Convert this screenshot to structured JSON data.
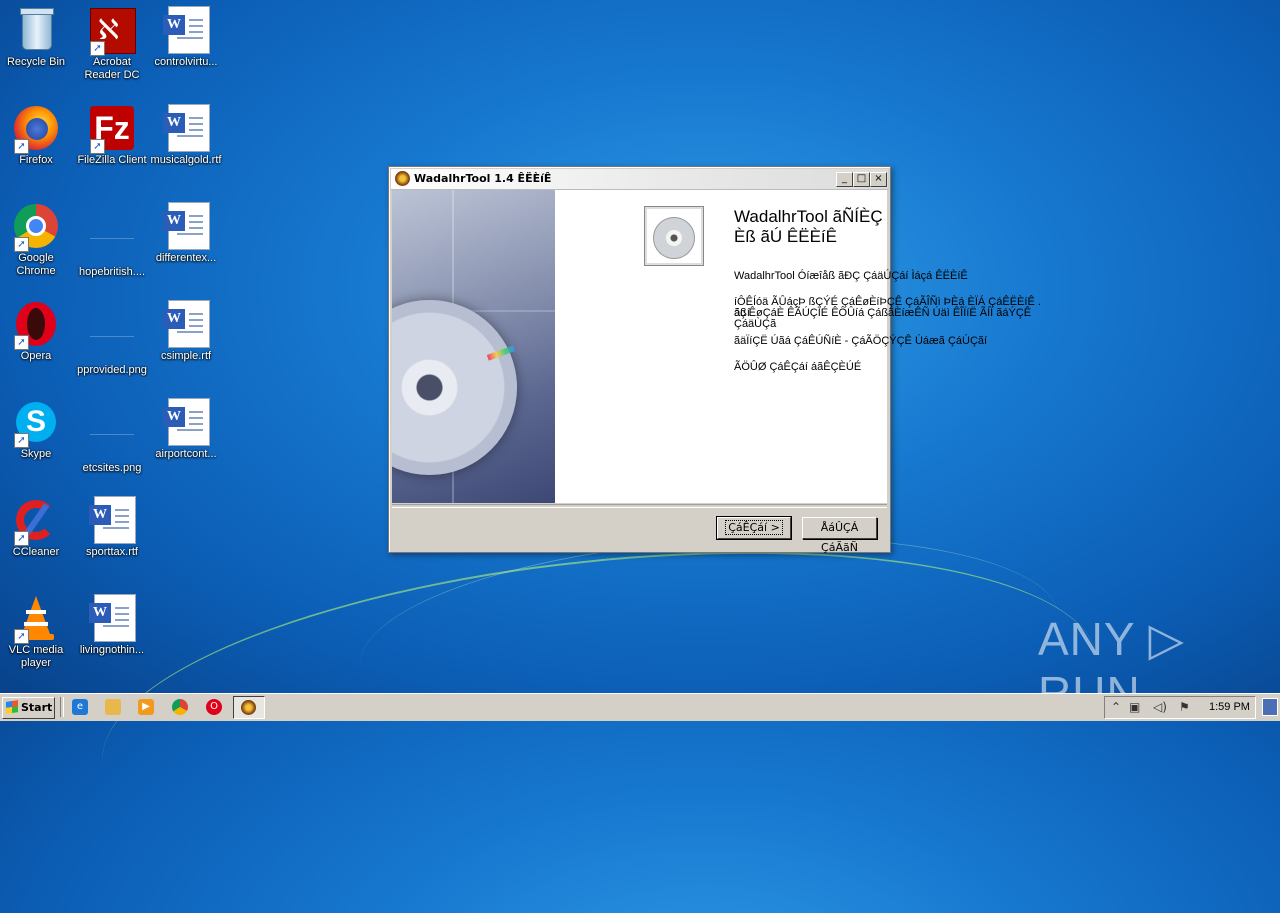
{
  "desktop": {
    "icons": [
      {
        "label": "Recycle Bin",
        "icon": "recycle-bin-icon"
      },
      {
        "label": "Acrobat Reader DC",
        "icon": "acrobat-icon"
      },
      {
        "label": "controlvirtu...",
        "icon": "word-doc-icon"
      },
      {
        "label": "Firefox",
        "icon": "firefox-icon"
      },
      {
        "label": "FileZilla Client",
        "icon": "filezilla-icon"
      },
      {
        "label": "musicalgold.rtf",
        "icon": "word-doc-icon"
      },
      {
        "label": "Google Chrome",
        "icon": "chrome-icon"
      },
      {
        "label": "hopebritish....",
        "icon": "image-file-icon"
      },
      {
        "label": "differentex...",
        "icon": "word-doc-icon"
      },
      {
        "label": "Opera",
        "icon": "opera-icon"
      },
      {
        "label": "pprovided.png",
        "icon": "image-file-icon"
      },
      {
        "label": "csimple.rtf",
        "icon": "word-doc-icon"
      },
      {
        "label": "Skype",
        "icon": "skype-icon"
      },
      {
        "label": "etcsites.png",
        "icon": "image-file-icon"
      },
      {
        "label": "airportcont...",
        "icon": "word-doc-icon"
      },
      {
        "label": "CCleaner",
        "icon": "ccleaner-icon"
      },
      {
        "label": "sporttax.rtf",
        "icon": "word-doc-icon"
      },
      {
        "label": "VLC media player",
        "icon": "vlc-icon"
      },
      {
        "label": "livingnothin...",
        "icon": "word-doc-icon"
      }
    ]
  },
  "window": {
    "title": "WadalhrTool 1.4 ÊËÈíÊ",
    "heading": "WadalhrTool ãÑÍÈÇ Èß ãÚ ÊËÈíÊ",
    "para1": "WadalhrTool Óíæîåß ãÐÇ ÇáäÚÇáí Ìáçá ÊËÈíÊ",
    "para2_line1": "íÔÊÍóä ÃÛáçÞ ßÇÝÉ ÇáÊøÈíÞÇÊ ÇáÃÎÑì ÞÈá ÈÏÁ ÇáÊËÈíÊ . ãßí",
    "para2_line2": "áç ÊøÇáÈ ÊÃÚÇÏÉ ÊÔÛíá ÇáßãÈíæÊÑ Úäì ÊÎÏíË ÃÍÏ ãáÝÇÊ",
    "para2_line3": "ÇáäÙÇã",
    "para3": "ãäÏíÇË Úãá ÇáÊÚÑíÈ - ÇáÃÖÇÝÇÊ Úáæã ÇáÚÇãí",
    "para4": "ÃÖÛØ ÇáÊÇáí áãÊÇÈÚÉ",
    "next_label": "ÇáÊÇáí >",
    "cancel_label": "ÅáÛÇÁ ÇáÃãÑ",
    "minimize": "_",
    "maximize": "□",
    "close": "×"
  },
  "taskbar": {
    "start_label": "Start",
    "quick_launch": [
      "ie-icon",
      "explorer-icon",
      "media-player-icon",
      "chrome-icon",
      "opera-icon"
    ],
    "active_task_icon": "wadalhrtool-icon",
    "tray_icons": [
      "show-hidden-icon",
      "network-icon",
      "volume-icon",
      "flag-icon"
    ],
    "clock": "1:59 PM"
  },
  "watermark": "ANY ▷ RUN"
}
